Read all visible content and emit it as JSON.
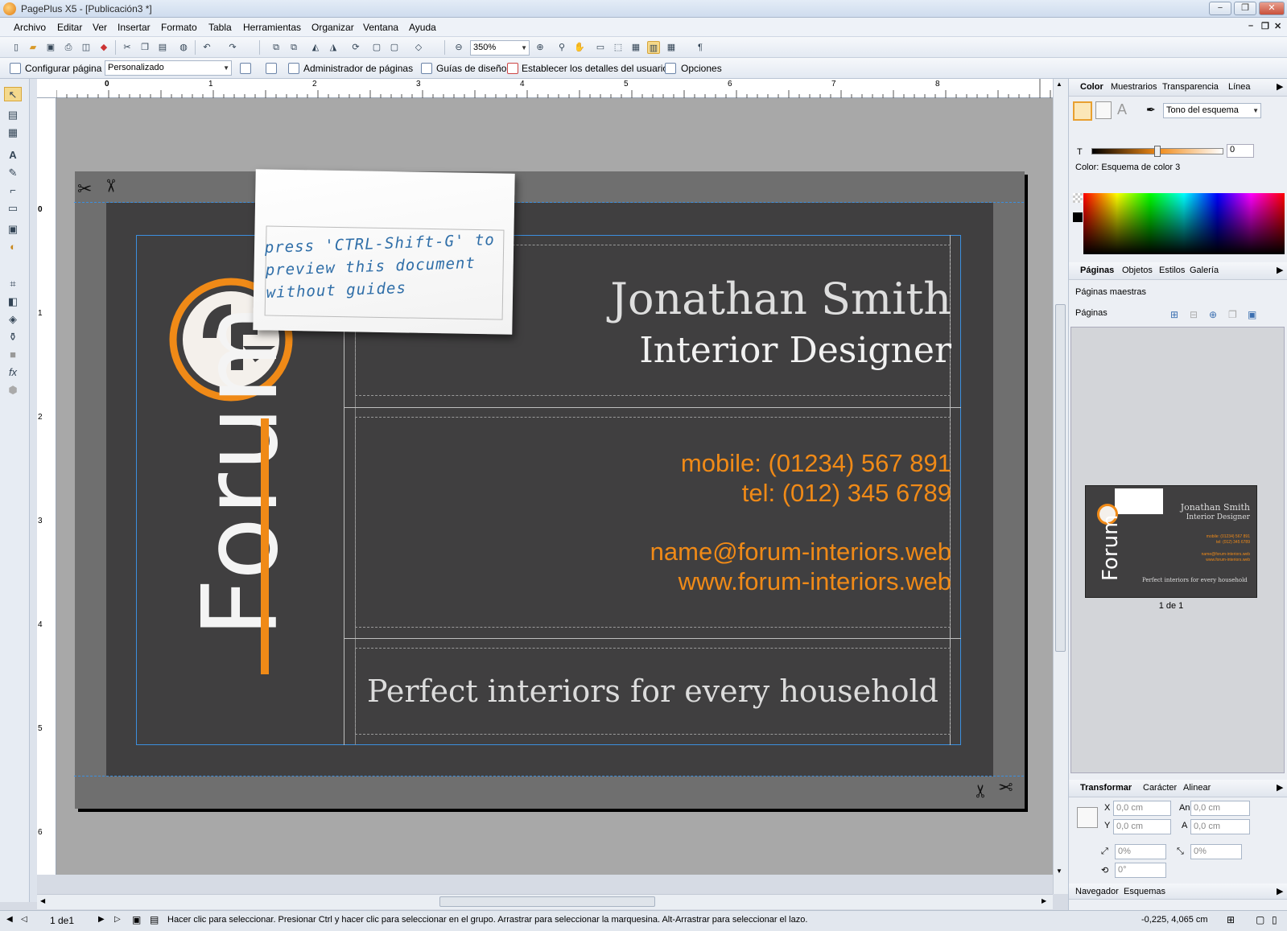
{
  "window": {
    "title": "PagePlus X5 - [Publicación3 *]",
    "controls": [
      "−",
      "❐",
      "✕"
    ],
    "mdi_controls": [
      "–",
      "❐",
      "✕"
    ]
  },
  "menu": [
    "Archivo",
    "Editar",
    "Ver",
    "Insertar",
    "Formato",
    "Tabla",
    "Herramientas",
    "Organizar",
    "Ventana",
    "Ayuda"
  ],
  "toolbar": {
    "zoom": "350%",
    "zoom_icon": "magnifier-icon"
  },
  "toolbar2": {
    "configure_page": "Configurar página",
    "page_size": "Personalizado",
    "page_manager": "Administrador de páginas",
    "design_guides": "Guías de diseño",
    "user_details": "Establecer los detalles del usuario",
    "options": "Opciones"
  },
  "ruler": {
    "corner": "L",
    "top_labels": [
      "0",
      "1",
      "2",
      "3",
      "4",
      "5",
      "6",
      "7",
      "8"
    ],
    "left_labels": [
      "0",
      "1",
      "2",
      "3",
      "4",
      "5",
      "6"
    ]
  },
  "card": {
    "name": "Jonathan Smith",
    "title": "Interior Designer",
    "mobile": "mobile: (01234) 567 891",
    "tel": "tel: (012) 345 6789",
    "email": "name@forum-interiors.web",
    "web": "www.forum-interiors.web",
    "tagline": "Perfect interiors for every household",
    "logo_text": "Forum",
    "note": "press 'CTRL-Shift-G' to preview this document without guides",
    "colors": {
      "background": "#403f40",
      "accent": "#f08a17",
      "text": "#dcdcdc",
      "pasteboard": "#6f6f6f"
    }
  },
  "color_panel": {
    "tabs": [
      "Color",
      "Muestrarios",
      "Transparencia",
      "Línea"
    ],
    "scheme_select": "Tono del esquema",
    "t_label": "T",
    "t_value": "0",
    "t_level": 0.5,
    "color_label": "Color: Esquema de color 3"
  },
  "pages_panel": {
    "tabs": [
      "Páginas",
      "Objetos",
      "Estilos",
      "Galería"
    ],
    "master_pages": "Páginas maestras",
    "pages_label": "Páginas",
    "page_count": "1 de 1"
  },
  "transform_panel": {
    "tabs": [
      "Transformar",
      "Carácter",
      "Alinear"
    ],
    "x_label": "X",
    "x_value": "0,0 cm",
    "y_label": "Y",
    "y_value": "0,0 cm",
    "w_label": "An",
    "w_value": "0,0 cm",
    "h_label": "A",
    "h_value": "0,0 cm",
    "scale_x": "0%",
    "scale_y": "0%",
    "rotate": "0°"
  },
  "bottom_panel": {
    "tabs": [
      "Navegador",
      "Esquemas"
    ]
  },
  "status": {
    "page": "1 de1",
    "hint": "Hacer clic para seleccionar. Presionar Ctrl y hacer clic para seleccionar en el grupo. Arrastrar para seleccionar la marquesina. Alt-Arrastrar para seleccionar el lazo.",
    "coords": "-0,225, 4,065 cm"
  }
}
